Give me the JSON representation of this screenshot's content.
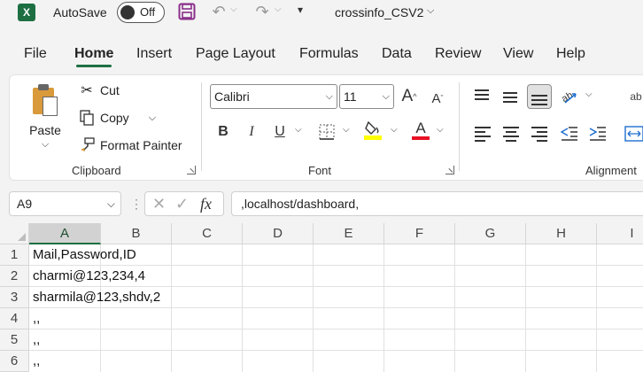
{
  "titlebar": {
    "logo_letter": "X",
    "autosave_label": "AutoSave",
    "autosave_state": "Off",
    "doc_title": "crossinfo_CSV2"
  },
  "menu": {
    "tabs": [
      "File",
      "Home",
      "Insert",
      "Page Layout",
      "Formulas",
      "Data",
      "Review",
      "View",
      "Help"
    ],
    "active": "Home"
  },
  "ribbon": {
    "clipboard": {
      "paste_label": "Paste",
      "cut_label": "Cut",
      "copy_label": "Copy",
      "format_painter_label": "Format Painter",
      "group_label": "Clipboard"
    },
    "font": {
      "font_name": "Calibri",
      "font_size": "11",
      "group_label": "Font",
      "bold": "B",
      "italic": "I",
      "underline": "U",
      "increase_size": "A",
      "decrease_size": "A",
      "font_color_letter": "A",
      "highlight_color": "#ffff00",
      "font_color": "#e81123"
    },
    "alignment": {
      "group_label": "Alignment"
    }
  },
  "formula_bar": {
    "name_box": "A9",
    "fx": "fx",
    "value": ",localhost/dashboard,"
  },
  "sheet": {
    "columns": [
      "A",
      "B",
      "C",
      "D",
      "E",
      "F",
      "G",
      "H",
      "I"
    ],
    "selected_column": "A",
    "rows": [
      {
        "num": "1",
        "a": "Mail,Password,ID"
      },
      {
        "num": "2",
        "a": "charmi@123,234,4"
      },
      {
        "num": "3",
        "a": "sharmila@123,shdv,2"
      },
      {
        "num": "4",
        "a": ",,"
      },
      {
        "num": "5",
        "a": ",,"
      },
      {
        "num": "6",
        "a": ",,"
      }
    ]
  },
  "colors": {
    "accent": "#1d6f42",
    "save_icon": "#8a2f8a"
  }
}
